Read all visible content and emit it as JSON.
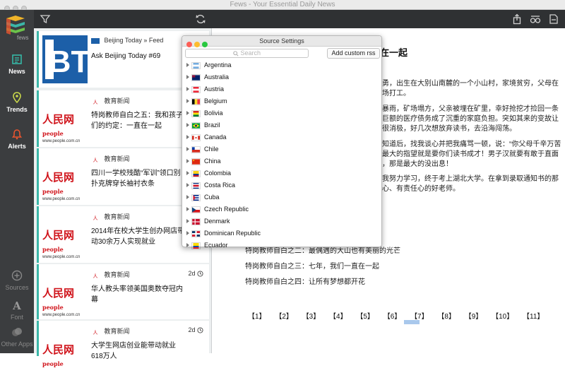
{
  "window": {
    "title": "Fews - Your Essential Daily News"
  },
  "sidebar": {
    "logo_text": "fews",
    "nav": [
      {
        "label": "News"
      },
      {
        "label": "Trends"
      },
      {
        "label": "Alerts"
      }
    ],
    "bottom": [
      {
        "label": "Sources"
      },
      {
        "label": "Font"
      },
      {
        "label": "Other Apps"
      }
    ]
  },
  "feed": {
    "cards": [
      {
        "source": "Beijing Today » Feed",
        "title": "Ask Beijing Today #69",
        "age": ""
      },
      {
        "source": "教育新闻",
        "title": "特岗教师自白之五：我和孩子们的约定：一直在一起",
        "age": ""
      },
      {
        "source": "教育新闻",
        "title": "四川一学校残酷“军训”领口别扑克牌穿长袖衬衣条",
        "age": ""
      },
      {
        "source": "教育新闻",
        "title": "2014年在校大学生创办网店带动30余万人实现就业",
        "age": ""
      },
      {
        "source": "教育新闻",
        "title": "华人教头率领美国奥数夺冠内幕",
        "age": "2d"
      },
      {
        "source": "教育新闻",
        "title": "大学生网店创业能带动就业618万人",
        "age": "2d"
      }
    ],
    "thumb_people": "人民网",
    "thumb_people_latin": "people",
    "thumb_people_url": "www.people.com.cn"
  },
  "article": {
    "heading": "在一起",
    "paragraphs": [
      "勇，出生在大别山南麓的一个小山村，家境贫穷，父母在",
      "场打工。",
      "暴雨，矿场塌方，父亲被埋在矿里，幸好抢挖才捡回一条",
      "巨额的医疗债务成了沉重的家庭负担。突如其来的变故让",
      "很消极，好几次想放弃读书，去沿海闯荡。",
      "知道后，找我谈心并把我痛骂一顿，说：“你父母千辛万苦",
      "最大的指望就是要你们读书成才！男子汉就要有敢于直面",
      "，那是最大的没出息！",
      "我努力学习，终于考上湖北大学。在拿到录取通知书的那",
      "心、有责任心的好老师。"
    ],
    "links": [
      "特岗教师自白之二：最偶遇的大山也有美丽的光芒",
      "特岗教师自白之三：七年，我们一直在一起",
      "特岗教师自白之四：让所有梦想都开花"
    ],
    "pages": [
      "【1】",
      "【2】",
      "【3】",
      "【4】",
      "【5】",
      "【6】",
      "【7】",
      "【8】",
      "【9】",
      "【10】",
      "【11】"
    ]
  },
  "dialog": {
    "title": "Source Settings",
    "search_placeholder": "Search",
    "add_button": "Add custom rss",
    "countries": [
      "Argentina",
      "Australia",
      "Austria",
      "Belgium",
      "Bolivia",
      "Brazil",
      "Canada",
      "Chile",
      "China",
      "Colombia",
      "Costa Rica",
      "Cuba",
      "Czech Republic",
      "Denmark",
      "Dominican Republic",
      "Ecuador"
    ]
  },
  "colors": {
    "accent": "#3bb7a8",
    "sidebar": "#3b3d3f",
    "toolbar": "#2f3133",
    "alert": "#e8542f",
    "trend": "#c8d64a",
    "news": "#36b8a6"
  }
}
